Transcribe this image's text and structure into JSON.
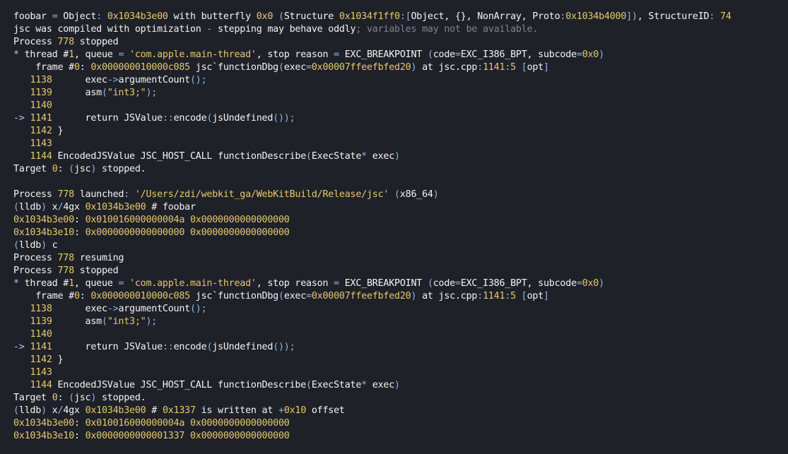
{
  "colors": {
    "background": "#1f2128",
    "text": "#f4f4f4",
    "number": "#e6c86e",
    "string": "#e6c86e",
    "keyword": "#9bd0ff",
    "comment": "#7d8591",
    "punct": "#8ab4e8"
  },
  "terminal": {
    "lines": [
      {
        "tokens": [
          [
            "foobar ",
            "t"
          ],
          [
            "=",
            "p"
          ],
          [
            " Object",
            ""
          ],
          [
            ":",
            "p"
          ],
          [
            " ",
            ""
          ],
          [
            "0x1034b3e00",
            "n"
          ],
          [
            " with butterfly ",
            ""
          ],
          [
            "0x0",
            "n"
          ],
          [
            " ",
            ""
          ],
          [
            "(",
            "p"
          ],
          [
            "Structure ",
            ""
          ],
          [
            "0x1034f1ff0",
            "n"
          ],
          [
            ":",
            "p"
          ],
          [
            "[",
            "p"
          ],
          [
            "Object, {}, NonArray, Proto",
            ""
          ],
          [
            ":",
            "p"
          ],
          [
            "0x1034b4000",
            "n"
          ],
          [
            "])",
            "p"
          ],
          [
            ", StructureID",
            ""
          ],
          [
            ":",
            "p"
          ],
          [
            " ",
            ""
          ],
          [
            "74",
            "n"
          ]
        ]
      },
      {
        "tokens": [
          [
            "jsc was compiled with optimization ",
            ""
          ],
          [
            "-",
            "p"
          ],
          [
            " stepping may behave oddly",
            ""
          ],
          [
            "; variables may not be available.",
            "c"
          ]
        ]
      },
      {
        "tokens": [
          [
            "Process ",
            ""
          ],
          [
            "778",
            "n"
          ],
          [
            " stopped",
            ""
          ]
        ]
      },
      {
        "tokens": [
          [
            "*",
            "k"
          ],
          [
            " thread #",
            ""
          ],
          [
            "1",
            "n"
          ],
          [
            ", queue ",
            ""
          ],
          [
            "=",
            "p"
          ],
          [
            " ",
            ""
          ],
          [
            "'com.apple.main-thread'",
            "s"
          ],
          [
            ", stop reason ",
            ""
          ],
          [
            "=",
            "p"
          ],
          [
            " EXC_BREAKPOINT ",
            ""
          ],
          [
            "(",
            "p"
          ],
          [
            "code",
            ""
          ],
          [
            "=",
            "p"
          ],
          [
            "EXC_I386_BPT, subcode",
            ""
          ],
          [
            "=",
            "p"
          ],
          [
            "0x0",
            "n"
          ],
          [
            ")",
            "p"
          ]
        ]
      },
      {
        "tokens": [
          [
            "    frame #",
            ""
          ],
          [
            "0",
            "n"
          ],
          [
            ": ",
            ""
          ],
          [
            "0x000000010000c085",
            "n"
          ],
          [
            " jsc`functionDbg",
            ""
          ],
          [
            "(",
            "p"
          ],
          [
            "exec",
            ""
          ],
          [
            "=",
            "p"
          ],
          [
            "0x00007ffeefbfed20",
            "n"
          ],
          [
            ")",
            "p"
          ],
          [
            " at jsc.cpp",
            ""
          ],
          [
            ":",
            "p"
          ],
          [
            "1141",
            "n"
          ],
          [
            ":",
            "p"
          ],
          [
            "5",
            "n"
          ],
          [
            " ",
            ""
          ],
          [
            "[",
            "p"
          ],
          [
            "opt",
            ""
          ],
          [
            "]",
            "p"
          ]
        ]
      },
      {
        "tokens": [
          [
            "   ",
            ""
          ],
          [
            "1138",
            "n"
          ],
          [
            "      exec",
            ""
          ],
          [
            "->",
            "p"
          ],
          [
            "argumentCount",
            ""
          ],
          [
            "();",
            "p"
          ]
        ]
      },
      {
        "tokens": [
          [
            "   ",
            ""
          ],
          [
            "1139",
            "n"
          ],
          [
            "      asm",
            ""
          ],
          [
            "(",
            "p"
          ],
          [
            "\"int3;\"",
            "s"
          ],
          [
            ");",
            "p"
          ]
        ]
      },
      {
        "tokens": [
          [
            "   ",
            ""
          ],
          [
            "1140",
            "n"
          ]
        ]
      },
      {
        "tokens": [
          [
            "->",
            "k"
          ],
          [
            " ",
            ""
          ],
          [
            "1141",
            "n"
          ],
          [
            "      return JSValue",
            ""
          ],
          [
            "::",
            "p"
          ],
          [
            "encode",
            ""
          ],
          [
            "(",
            "p"
          ],
          [
            "jsUndefined",
            ""
          ],
          [
            "());",
            "p"
          ]
        ]
      },
      {
        "tokens": [
          [
            "   ",
            ""
          ],
          [
            "1142",
            "n"
          ],
          [
            " }",
            ""
          ]
        ]
      },
      {
        "tokens": [
          [
            "   ",
            ""
          ],
          [
            "1143",
            "n"
          ]
        ]
      },
      {
        "tokens": [
          [
            "   ",
            ""
          ],
          [
            "1144",
            "n"
          ],
          [
            " EncodedJSValue JSC_HOST_CALL functionDescribe",
            ""
          ],
          [
            "(",
            "p"
          ],
          [
            "ExecState",
            ""
          ],
          [
            "*",
            "p"
          ],
          [
            " exec",
            ""
          ],
          [
            ")",
            "p"
          ]
        ]
      },
      {
        "tokens": [
          [
            "Target ",
            ""
          ],
          [
            "0",
            "n"
          ],
          [
            ": ",
            ""
          ],
          [
            "(",
            "p"
          ],
          [
            "jsc",
            ""
          ],
          [
            ")",
            "p"
          ],
          [
            " stopped.",
            ""
          ]
        ]
      },
      {
        "tokens": []
      },
      {
        "tokens": [
          [
            "Process ",
            ""
          ],
          [
            "778",
            "n"
          ],
          [
            " launched",
            ""
          ],
          [
            ":",
            "p"
          ],
          [
            " ",
            ""
          ],
          [
            "'/Users/zdi/webkit_ga/WebKitBuild/Release/jsc'",
            "s"
          ],
          [
            " ",
            ""
          ],
          [
            "(",
            "p"
          ],
          [
            "x86_64",
            ""
          ],
          [
            ")",
            "p"
          ]
        ]
      },
      {
        "tokens": [
          [
            "(",
            "p"
          ],
          [
            "lldb",
            ""
          ],
          [
            ")",
            "p"
          ],
          [
            " x",
            ""
          ],
          [
            "/",
            "p"
          ],
          [
            "4gx ",
            ""
          ],
          [
            "0x1034b3e00",
            "n"
          ],
          [
            " # foobar",
            ""
          ]
        ]
      },
      {
        "tokens": [
          [
            "0x1034b3e00",
            "n"
          ],
          [
            ": ",
            ""
          ],
          [
            "0x010016000000004a",
            "n"
          ],
          [
            " ",
            ""
          ],
          [
            "0x0000000000000000",
            "n"
          ]
        ]
      },
      {
        "tokens": [
          [
            "0x1034b3e10",
            "n"
          ],
          [
            ": ",
            ""
          ],
          [
            "0x0000000000000000",
            "n"
          ],
          [
            " ",
            ""
          ],
          [
            "0x0000000000000000",
            "n"
          ]
        ]
      },
      {
        "tokens": [
          [
            "(",
            "p"
          ],
          [
            "lldb",
            ""
          ],
          [
            ")",
            "p"
          ],
          [
            " c",
            ""
          ]
        ]
      },
      {
        "tokens": [
          [
            "Process ",
            ""
          ],
          [
            "778",
            "n"
          ],
          [
            " resuming",
            ""
          ]
        ]
      },
      {
        "tokens": [
          [
            "Process ",
            ""
          ],
          [
            "778",
            "n"
          ],
          [
            " stopped",
            ""
          ]
        ]
      },
      {
        "tokens": [
          [
            "*",
            "k"
          ],
          [
            " thread #",
            ""
          ],
          [
            "1",
            "n"
          ],
          [
            ", queue ",
            ""
          ],
          [
            "=",
            "p"
          ],
          [
            " ",
            ""
          ],
          [
            "'com.apple.main-thread'",
            "s"
          ],
          [
            ", stop reason ",
            ""
          ],
          [
            "=",
            "p"
          ],
          [
            " EXC_BREAKPOINT ",
            ""
          ],
          [
            "(",
            "p"
          ],
          [
            "code",
            ""
          ],
          [
            "=",
            "p"
          ],
          [
            "EXC_I386_BPT, subcode",
            ""
          ],
          [
            "=",
            "p"
          ],
          [
            "0x0",
            "n"
          ],
          [
            ")",
            "p"
          ]
        ]
      },
      {
        "tokens": [
          [
            "    frame #",
            ""
          ],
          [
            "0",
            "n"
          ],
          [
            ": ",
            ""
          ],
          [
            "0x000000010000c085",
            "n"
          ],
          [
            " jsc`functionDbg",
            ""
          ],
          [
            "(",
            "p"
          ],
          [
            "exec",
            ""
          ],
          [
            "=",
            "p"
          ],
          [
            "0x00007ffeefbfed20",
            "n"
          ],
          [
            ")",
            "p"
          ],
          [
            " at jsc.cpp",
            ""
          ],
          [
            ":",
            "p"
          ],
          [
            "1141",
            "n"
          ],
          [
            ":",
            "p"
          ],
          [
            "5",
            "n"
          ],
          [
            " ",
            ""
          ],
          [
            "[",
            "p"
          ],
          [
            "opt",
            ""
          ],
          [
            "]",
            "p"
          ]
        ]
      },
      {
        "tokens": [
          [
            "   ",
            ""
          ],
          [
            "1138",
            "n"
          ],
          [
            "      exec",
            ""
          ],
          [
            "->",
            "p"
          ],
          [
            "argumentCount",
            ""
          ],
          [
            "();",
            "p"
          ]
        ]
      },
      {
        "tokens": [
          [
            "   ",
            ""
          ],
          [
            "1139",
            "n"
          ],
          [
            "      asm",
            ""
          ],
          [
            "(",
            "p"
          ],
          [
            "\"int3;\"",
            "s"
          ],
          [
            ");",
            "p"
          ]
        ]
      },
      {
        "tokens": [
          [
            "   ",
            ""
          ],
          [
            "1140",
            "n"
          ]
        ]
      },
      {
        "tokens": [
          [
            "->",
            "k"
          ],
          [
            " ",
            ""
          ],
          [
            "1141",
            "n"
          ],
          [
            "      return JSValue",
            ""
          ],
          [
            "::",
            "p"
          ],
          [
            "encode",
            ""
          ],
          [
            "(",
            "p"
          ],
          [
            "jsUndefined",
            ""
          ],
          [
            "());",
            "p"
          ]
        ]
      },
      {
        "tokens": [
          [
            "   ",
            ""
          ],
          [
            "1142",
            "n"
          ],
          [
            " }",
            ""
          ]
        ]
      },
      {
        "tokens": [
          [
            "   ",
            ""
          ],
          [
            "1143",
            "n"
          ]
        ]
      },
      {
        "tokens": [
          [
            "   ",
            ""
          ],
          [
            "1144",
            "n"
          ],
          [
            " EncodedJSValue JSC_HOST_CALL functionDescribe",
            ""
          ],
          [
            "(",
            "p"
          ],
          [
            "ExecState",
            ""
          ],
          [
            "*",
            "p"
          ],
          [
            " exec",
            ""
          ],
          [
            ")",
            "p"
          ]
        ]
      },
      {
        "tokens": [
          [
            "Target ",
            ""
          ],
          [
            "0",
            "n"
          ],
          [
            ": ",
            ""
          ],
          [
            "(",
            "p"
          ],
          [
            "jsc",
            ""
          ],
          [
            ")",
            "p"
          ],
          [
            " stopped.",
            ""
          ]
        ]
      },
      {
        "tokens": [
          [
            "(",
            "p"
          ],
          [
            "lldb",
            ""
          ],
          [
            ")",
            "p"
          ],
          [
            " x",
            ""
          ],
          [
            "/",
            "p"
          ],
          [
            "4gx ",
            ""
          ],
          [
            "0x1034b3e00",
            "n"
          ],
          [
            " # ",
            ""
          ],
          [
            "0x1337",
            "n"
          ],
          [
            " is written at ",
            ""
          ],
          [
            "+",
            "p"
          ],
          [
            "0x10",
            "n"
          ],
          [
            " offset",
            ""
          ]
        ]
      },
      {
        "tokens": [
          [
            "0x1034b3e00",
            "n"
          ],
          [
            ": ",
            ""
          ],
          [
            "0x010016000000004a",
            "n"
          ],
          [
            " ",
            ""
          ],
          [
            "0x0000000000000000",
            "n"
          ]
        ]
      },
      {
        "tokens": [
          [
            "0x1034b3e10",
            "n"
          ],
          [
            ": ",
            ""
          ],
          [
            "0x0000000000001337",
            "n"
          ],
          [
            " ",
            ""
          ],
          [
            "0x0000000000000000",
            "n"
          ]
        ]
      }
    ]
  }
}
